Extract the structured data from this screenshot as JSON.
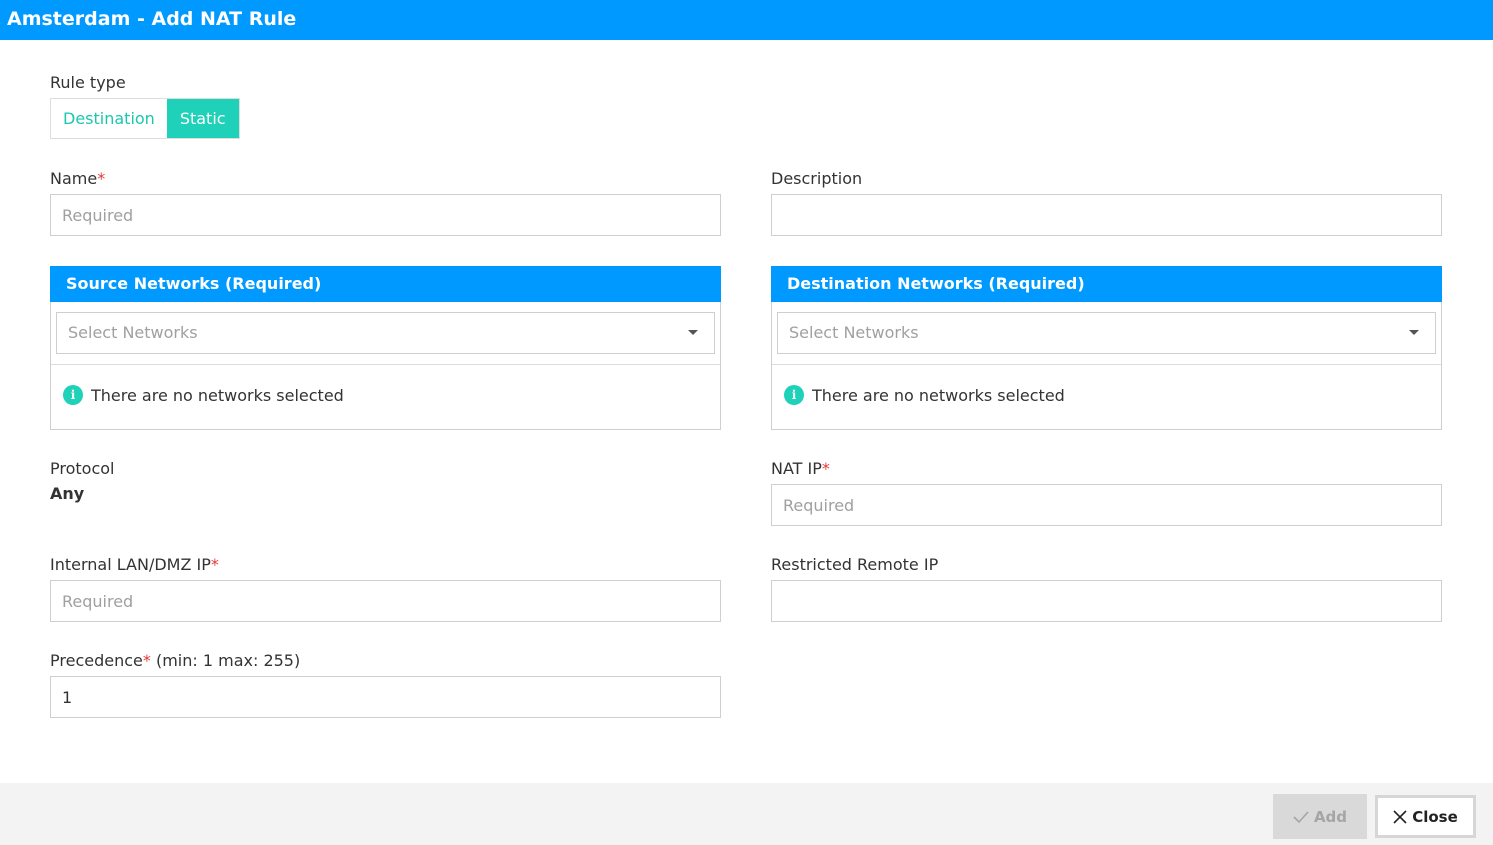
{
  "dialog": {
    "title": "Amsterdam - Add NAT Rule"
  },
  "rule_type": {
    "label": "Rule type",
    "options": [
      "Destination",
      "Static"
    ],
    "selected": "Static"
  },
  "name": {
    "label": "Name",
    "required_mark": "*",
    "placeholder": "Required",
    "value": ""
  },
  "description": {
    "label": "Description",
    "placeholder": "",
    "value": ""
  },
  "source_networks": {
    "title": "Source Networks (Required)",
    "select_placeholder": "Select Networks",
    "empty_message": "There are no networks selected"
  },
  "destination_networks": {
    "title": "Destination Networks (Required)",
    "select_placeholder": "Select Networks",
    "empty_message": "There are no networks selected"
  },
  "protocol": {
    "label": "Protocol",
    "value": "Any"
  },
  "nat_ip": {
    "label": "NAT IP",
    "required_mark": "*",
    "placeholder": "Required",
    "value": ""
  },
  "internal_ip": {
    "label": "Internal LAN/DMZ IP",
    "required_mark": "*",
    "placeholder": "Required",
    "value": ""
  },
  "restricted_remote_ip": {
    "label": "Restricted Remote IP",
    "placeholder": "",
    "value": ""
  },
  "precedence": {
    "label": "Precedence",
    "required_mark": "*",
    "hint": "(min: 1 max: 255)",
    "value": "1"
  },
  "footer": {
    "add_label": "Add",
    "add_icon": "check-icon",
    "close_label": "Close",
    "close_icon": "close-icon"
  },
  "colors": {
    "header_blue": "#0099ff",
    "accent_teal": "#1ed1b8",
    "required_red": "#e53935"
  }
}
